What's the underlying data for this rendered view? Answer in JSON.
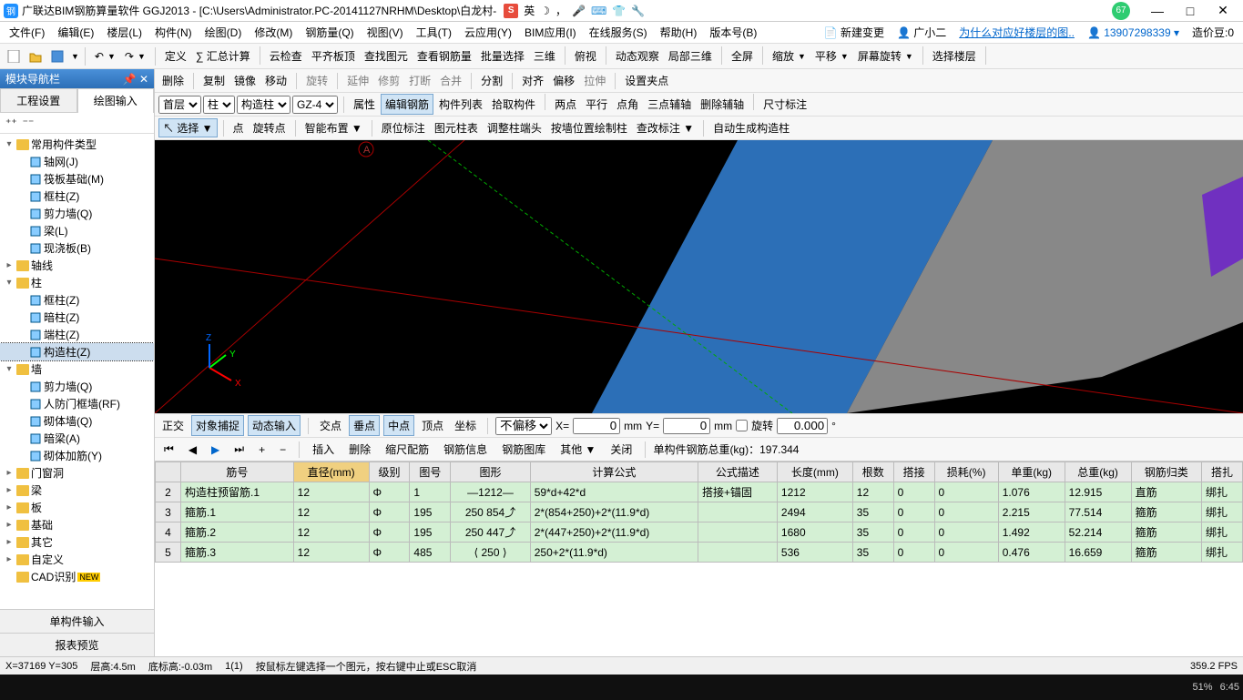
{
  "title": "广联达BIM钢筋算量软件 GGJ2013 - [C:\\Users\\Administrator.PC-20141127NRHM\\Desktop\\白龙村-",
  "ime": {
    "badge": "S",
    "lang": "英",
    "moon": "☽"
  },
  "badge67": "67",
  "menubar": [
    "文件(F)",
    "编辑(E)",
    "楼层(L)",
    "构件(N)",
    "绘图(D)",
    "修改(M)",
    "钢筋量(Q)",
    "视图(V)",
    "工具(T)",
    "云应用(Y)",
    "BIM应用(I)",
    "在线服务(S)",
    "帮助(H)",
    "版本号(B)"
  ],
  "menubar_right": {
    "new_change": "新建变更",
    "user": "广小二",
    "help_link": "为什么对应好楼层的图..",
    "account": "13907298339",
    "coin_label": "造价豆:0"
  },
  "toolbar2_items": [
    "定义",
    "∑ 汇总计算",
    "云检查",
    "平齐板顶",
    "查找图元",
    "查看钢筋量",
    "批量选择",
    "三维",
    "俯视",
    "动态观察",
    "局部三维",
    "全屏",
    "缩放",
    "平移",
    "屏幕旋转",
    "选择楼层"
  ],
  "edit_toolbar": [
    "删除",
    "复制",
    "镜像",
    "移动",
    "旋转",
    "延伸",
    "修剪",
    "打断",
    "合并",
    "分割",
    "对齐",
    "偏移",
    "拉伸",
    "设置夹点"
  ],
  "level_selects": {
    "floor": "首层",
    "type": "柱",
    "subtype": "构造柱",
    "member": "GZ-4"
  },
  "prop_toolbar": [
    "属性",
    "编辑钢筋",
    "构件列表",
    "拾取构件",
    "两点",
    "平行",
    "点角",
    "三点辅轴",
    "删除辅轴",
    "尺寸标注"
  ],
  "prop_active_index": 1,
  "draw_toolbar": [
    "选择",
    "点",
    "旋转点",
    "智能布置",
    "原位标注",
    "图元柱表",
    "调整柱端头",
    "按墙位置绘制柱",
    "查改标注",
    "自动生成构造柱"
  ],
  "left_panel": {
    "title": "模块导航栏",
    "tabs": [
      "工程设置",
      "绘图输入"
    ],
    "active_tab": 1,
    "tree": [
      {
        "l": 0,
        "exp": "▾",
        "icon": "folder",
        "label": "常用构件类型"
      },
      {
        "l": 1,
        "icon": "leaf",
        "label": "轴网(J)"
      },
      {
        "l": 1,
        "icon": "leaf",
        "label": "筏板基础(M)"
      },
      {
        "l": 1,
        "icon": "leaf",
        "label": "框柱(Z)"
      },
      {
        "l": 1,
        "icon": "leaf",
        "label": "剪力墙(Q)"
      },
      {
        "l": 1,
        "icon": "leaf",
        "label": "梁(L)"
      },
      {
        "l": 1,
        "icon": "leaf",
        "label": "现浇板(B)"
      },
      {
        "l": 0,
        "exp": "▸",
        "icon": "folder",
        "label": "轴线"
      },
      {
        "l": 0,
        "exp": "▾",
        "icon": "folder",
        "label": "柱"
      },
      {
        "l": 1,
        "icon": "leaf",
        "label": "框柱(Z)"
      },
      {
        "l": 1,
        "icon": "leaf",
        "label": "暗柱(Z)"
      },
      {
        "l": 1,
        "icon": "leaf",
        "label": "端柱(Z)"
      },
      {
        "l": 1,
        "icon": "leaf",
        "label": "构造柱(Z)",
        "selected": true
      },
      {
        "l": 0,
        "exp": "▾",
        "icon": "folder",
        "label": "墙"
      },
      {
        "l": 1,
        "icon": "leaf",
        "label": "剪力墙(Q)"
      },
      {
        "l": 1,
        "icon": "leaf",
        "label": "人防门框墙(RF)"
      },
      {
        "l": 1,
        "icon": "leaf",
        "label": "砌体墙(Q)"
      },
      {
        "l": 1,
        "icon": "leaf",
        "label": "暗梁(A)"
      },
      {
        "l": 1,
        "icon": "leaf",
        "label": "砌体加筋(Y)"
      },
      {
        "l": 0,
        "exp": "▸",
        "icon": "folder",
        "label": "门窗洞"
      },
      {
        "l": 0,
        "exp": "▸",
        "icon": "folder",
        "label": "梁"
      },
      {
        "l": 0,
        "exp": "▸",
        "icon": "folder",
        "label": "板"
      },
      {
        "l": 0,
        "exp": "▸",
        "icon": "folder",
        "label": "基础"
      },
      {
        "l": 0,
        "exp": "▸",
        "icon": "folder",
        "label": "其它"
      },
      {
        "l": 0,
        "exp": "▸",
        "icon": "folder",
        "label": "自定义"
      },
      {
        "l": 0,
        "exp": "",
        "icon": "folder",
        "label": "CAD识别",
        "new": true
      }
    ],
    "bottom_tabs": [
      "单构件输入",
      "报表预览"
    ]
  },
  "snapbar": {
    "items": [
      "正交",
      "对象捕捉",
      "动态输入",
      "交点",
      "垂点",
      "中点",
      "顶点",
      "坐标"
    ],
    "pressed": [
      1,
      2,
      4,
      5
    ],
    "offset_label": "不偏移",
    "x_label": "X=",
    "x_val": "0",
    "y_label": "Y=",
    "y_val": "0",
    "unit": "mm",
    "rot_label": "旋转",
    "rot_val": "0.000"
  },
  "navbar": {
    "btns": [
      "插入",
      "删除",
      "缩尺配筋",
      "钢筋信息",
      "钢筋图库",
      "其他",
      "关闭"
    ],
    "total_label": "单构件钢筋总重(kg)：",
    "total_val": "197.344"
  },
  "table": {
    "headers": [
      "筋号",
      "直径(mm)",
      "级别",
      "图号",
      "图形",
      "计算公式",
      "公式描述",
      "长度(mm)",
      "根数",
      "搭接",
      "损耗(%)",
      "单重(kg)",
      "总重(kg)",
      "钢筋归类",
      "搭扎"
    ],
    "sorted_col": 1,
    "rows": [
      {
        "n": 2,
        "c": [
          "构造柱预留筋.1",
          "12",
          "Φ",
          "1",
          "—1212—",
          "59*d+42*d",
          "搭接+锚固",
          "1212",
          "12",
          "0",
          "0",
          "1.076",
          "12.915",
          "直筋",
          "绑扎"
        ]
      },
      {
        "n": 3,
        "c": [
          "箍筋.1",
          "12",
          "Φ",
          "195",
          "250 854⤴",
          "2*(854+250)+2*(11.9*d)",
          "",
          "2494",
          "35",
          "0",
          "0",
          "2.215",
          "77.514",
          "箍筋",
          "绑扎"
        ]
      },
      {
        "n": 4,
        "c": [
          "箍筋.2",
          "12",
          "Φ",
          "195",
          "250 447⤴",
          "2*(447+250)+2*(11.9*d)",
          "",
          "1680",
          "35",
          "0",
          "0",
          "1.492",
          "52.214",
          "箍筋",
          "绑扎"
        ]
      },
      {
        "n": 5,
        "c": [
          "箍筋.3",
          "12",
          "Φ",
          "485",
          "⟨ 250 ⟩",
          "250+2*(11.9*d)",
          "",
          "536",
          "35",
          "0",
          "0",
          "0.476",
          "16.659",
          "箍筋",
          "绑扎"
        ]
      }
    ]
  },
  "statusbar": {
    "coord": "X=37169 Y=305",
    "floor_h": "层高:4.5m",
    "bottom_h": "底标高:-0.03m",
    "sel": "1(1)",
    "hint": "按鼠标左键选择一个图元，按右键中止或ESC取消",
    "fps": "359.2 FPS"
  },
  "taskbar": {
    "battery": "51%",
    "time": "6:45"
  },
  "viewport_label": "A"
}
